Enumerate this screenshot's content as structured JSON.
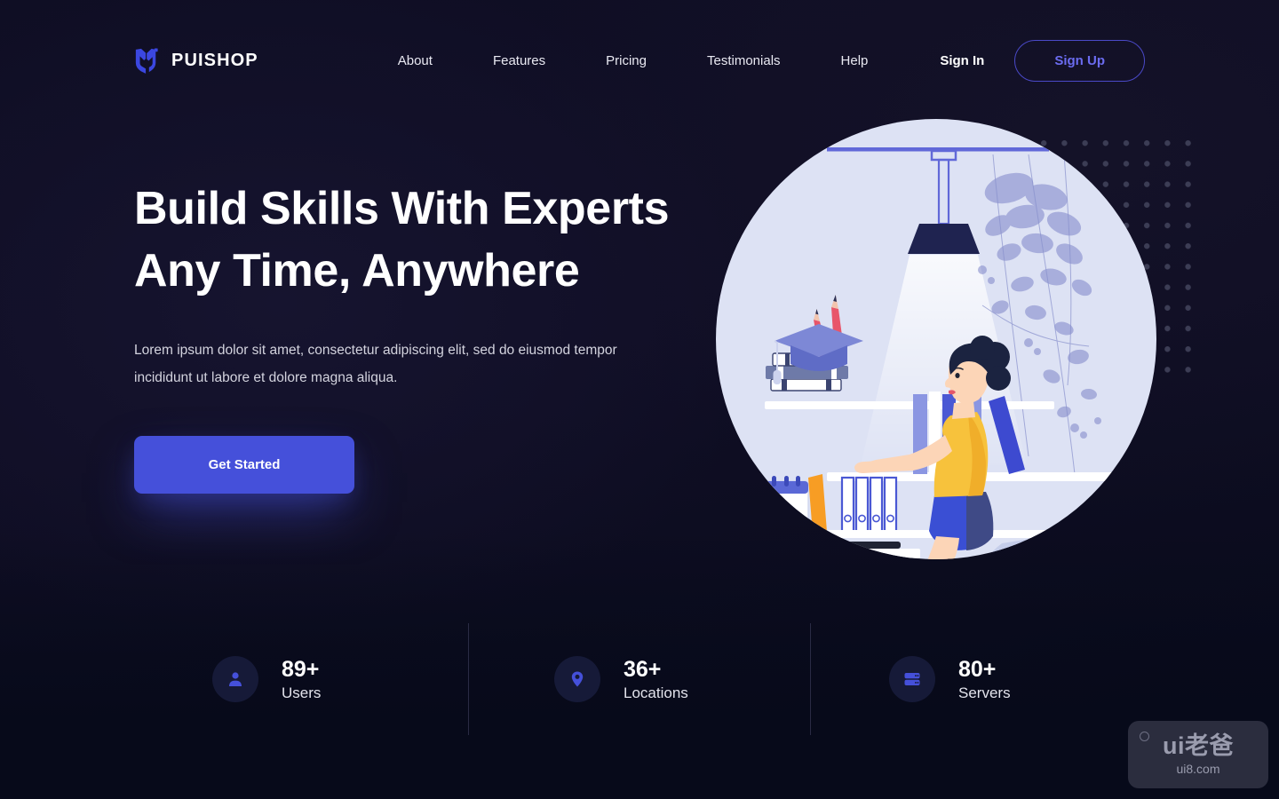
{
  "brand": {
    "name": "PUISHOP",
    "logo_icon": "m-shield-logo-icon",
    "accent": "#4550da"
  },
  "nav": {
    "items": [
      {
        "label": "About"
      },
      {
        "label": "Features"
      },
      {
        "label": "Pricing"
      },
      {
        "label": "Testimonials"
      },
      {
        "label": "Help"
      }
    ]
  },
  "auth": {
    "signin_label": "Sign In",
    "signup_label": "Sign Up",
    "signup_border_color": "#4a49c7",
    "signup_text_color": "#6b6cf0"
  },
  "hero": {
    "headline_line1": "Build Skills With Experts",
    "headline_line2": "Any Time, Anywhere",
    "subcopy_line1": "Lorem ipsum dolor sit amet, consectetur adipiscing elit, sed do eiusmod",
    "subcopy_line2": "tempor incididunt ut labore et dolore magna aliqua.",
    "cta_label": "Get Started",
    "cta_bg": "#4550da",
    "illustration": "woman-at-desk-with-computer-bookshelf-lamp-plant"
  },
  "stats": {
    "items": [
      {
        "value": "89+",
        "label": "Users",
        "icon": "user-icon"
      },
      {
        "value": "36+",
        "label": "Locations",
        "icon": "map-pin-icon"
      },
      {
        "value": "80+",
        "label": "Servers",
        "icon": "server-stack-icon"
      }
    ],
    "icon_color": "#4550da",
    "icon_bg": "#161a38"
  },
  "watermark": {
    "main": "ui老爸",
    "sub": "ui8.com"
  },
  "theme": {
    "background_top": "#0f0e24",
    "background_bottom": "#070a1a",
    "dot_color": "#3c3d55",
    "divider_color": "#2a2b44"
  }
}
